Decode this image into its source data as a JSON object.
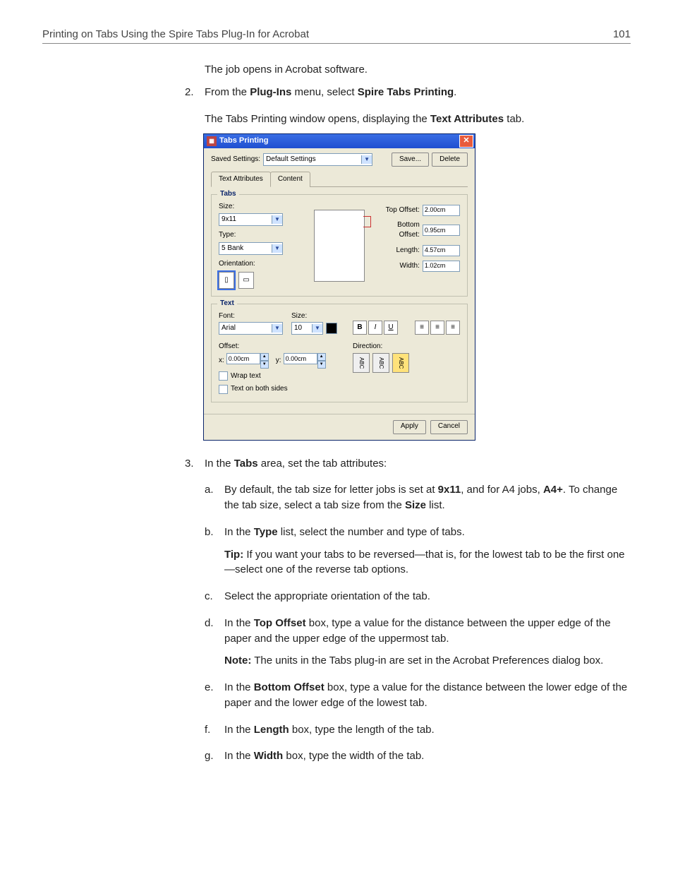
{
  "header": {
    "title": "Printing on Tabs Using the Spire Tabs Plug-In for Acrobat",
    "page": "101"
  },
  "intro": {
    "line1": "The job opens in Acrobat software."
  },
  "step2": {
    "num": "2.",
    "prefix": "From the ",
    "b1": "Plug-Ins",
    "mid": " menu, select ",
    "b2": "Spire Tabs Printing",
    "suffix": ".",
    "after_a": "The Tabs Printing window opens, displaying the ",
    "after_b": "Text Attributes",
    "after_c": " tab."
  },
  "dialog": {
    "title": "Tabs Printing",
    "saved_label": "Saved Settings:",
    "saved_value": "Default Settings",
    "save_btn": "Save...",
    "delete_btn": "Delete",
    "tab1": "Text Attributes",
    "tab2": "Content",
    "tabs_legend": "Tabs",
    "size_lbl": "Size:",
    "size_val": "9x11",
    "type_lbl": "Type:",
    "type_val": "5 Bank",
    "orient_lbl": "Orientation:",
    "top_offset_lbl": "Top Offset:",
    "top_offset_val": "2.00cm",
    "bottom_offset_lbl": "Bottom Offset:",
    "bottom_offset_val": "0.95cm",
    "length_lbl": "Length:",
    "length_val": "4.57cm",
    "width_lbl": "Width:",
    "width_val": "1.02cm",
    "text_legend": "Text",
    "font_lbl": "Font:",
    "font_val": "Arial",
    "fsize_lbl": "Size:",
    "fsize_val": "10",
    "bold": "B",
    "italic": "I",
    "under": "U",
    "offset_lbl": "Offset:",
    "x_lbl": "x:",
    "x_val": "0.00cm",
    "y_lbl": "y:",
    "y_val": "0.00cm",
    "wrap": "Wrap text",
    "both": "Text on both sides",
    "dir_lbl": "Direction:",
    "dir_a": "ABC",
    "dir_b": "ABC",
    "dir_c": "ABC",
    "apply": "Apply",
    "cancel": "Cancel"
  },
  "step3": {
    "num": "3.",
    "lead_a": "In the ",
    "lead_b": "Tabs",
    "lead_c": " area, set the tab attributes:",
    "a": {
      "num": "a.",
      "t1": "By default, the tab size for letter jobs is set at ",
      "b1": "9x11",
      "t2": ", and for A4 jobs, ",
      "b2": "A4+",
      "t3": ". To change the tab size, select a tab size from the ",
      "b3": "Size",
      "t4": " list."
    },
    "b": {
      "num": "b.",
      "t1": "In the ",
      "b1": "Type",
      "t2": " list, select the number and type of tabs.",
      "tip_b": "Tip:",
      "tip_t": " If you want your tabs to be reversed—that is, for the lowest tab to be the first one—select one of the reverse tab options."
    },
    "c": {
      "num": "c.",
      "t": "Select the appropriate orientation of the tab."
    },
    "d": {
      "num": "d.",
      "t1": "In the ",
      "b1": "Top Offset",
      "t2": " box, type a value for the distance between the upper edge of the paper and the upper edge of the uppermost tab.",
      "note_b": "Note:",
      "note_t": " The units in the Tabs plug-in are set in the Acrobat Preferences dialog box."
    },
    "e": {
      "num": "e.",
      "t1": "In the ",
      "b1": "Bottom Offset",
      "t2": " box, type a value for the distance between the lower edge of the paper and the lower edge of the lowest tab."
    },
    "f": {
      "num": "f.",
      "t1": "In the ",
      "b1": "Length",
      "t2": " box, type the length of the tab."
    },
    "g": {
      "num": "g.",
      "t1": "In the ",
      "b1": "Width",
      "t2": " box, type the width of the tab."
    }
  }
}
